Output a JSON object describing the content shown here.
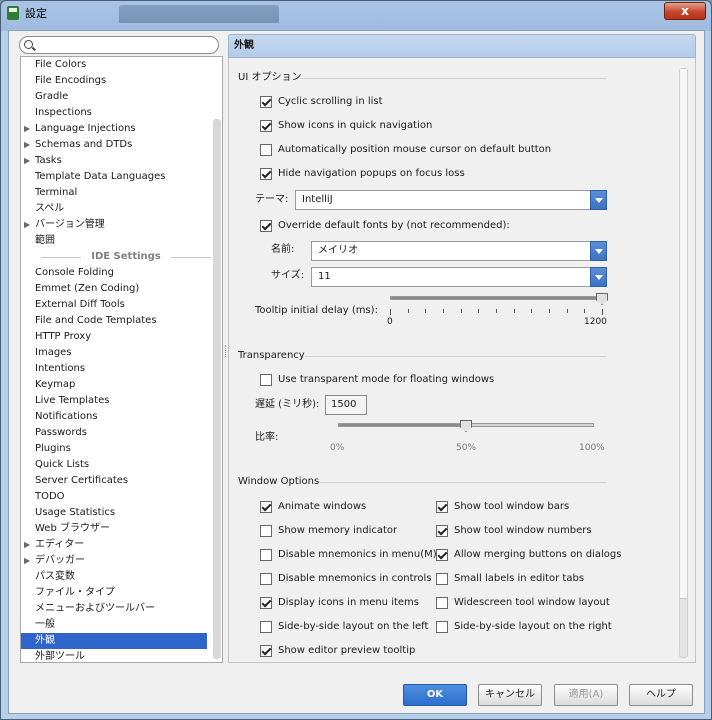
{
  "window": {
    "title": "設定",
    "close_label": "x"
  },
  "search": {
    "placeholder": ""
  },
  "tree": {
    "items_top": [
      {
        "label": "File Colors",
        "arrow": false
      },
      {
        "label": "File Encodings",
        "arrow": false
      },
      {
        "label": "Gradle",
        "arrow": false
      },
      {
        "label": "Inspections",
        "arrow": false
      },
      {
        "label": "Language Injections",
        "arrow": true
      },
      {
        "label": "Schemas and DTDs",
        "arrow": true
      },
      {
        "label": "Tasks",
        "arrow": true
      },
      {
        "label": "Template Data Languages",
        "arrow": false
      },
      {
        "label": "Terminal",
        "arrow": false
      },
      {
        "label": "スペル",
        "arrow": false
      },
      {
        "label": "バージョン管理",
        "arrow": true
      },
      {
        "label": "範囲",
        "arrow": false
      }
    ],
    "separator": "IDE Settings",
    "items_bottom": [
      {
        "label": "Console Folding",
        "arrow": false
      },
      {
        "label": "Emmet (Zen Coding)",
        "arrow": false
      },
      {
        "label": "External Diff Tools",
        "arrow": false
      },
      {
        "label": "File and Code Templates",
        "arrow": false
      },
      {
        "label": "HTTP Proxy",
        "arrow": false
      },
      {
        "label": "Images",
        "arrow": false
      },
      {
        "label": "Intentions",
        "arrow": false
      },
      {
        "label": "Keymap",
        "arrow": false
      },
      {
        "label": "Live Templates",
        "arrow": false
      },
      {
        "label": "Notifications",
        "arrow": false
      },
      {
        "label": "Passwords",
        "arrow": false
      },
      {
        "label": "Plugins",
        "arrow": false
      },
      {
        "label": "Quick Lists",
        "arrow": false
      },
      {
        "label": "Server Certificates",
        "arrow": false
      },
      {
        "label": "TODO",
        "arrow": false
      },
      {
        "label": "Usage Statistics",
        "arrow": false
      },
      {
        "label": "Web ブラウザー",
        "arrow": false
      },
      {
        "label": "エディター",
        "arrow": true
      },
      {
        "label": "デバッガー",
        "arrow": true
      },
      {
        "label": "パス変数",
        "arrow": false
      },
      {
        "label": "ファイル・タイプ",
        "arrow": false
      },
      {
        "label": "メニューおよびツールバー",
        "arrow": false
      },
      {
        "label": "一般",
        "arrow": false
      },
      {
        "label": "外観",
        "arrow": false,
        "selected": true
      },
      {
        "label": "外部ツール",
        "arrow": false
      }
    ]
  },
  "panel": {
    "title": "外観",
    "ui_options": {
      "heading": "UI オプション",
      "cyclic_scrolling": {
        "label": "Cyclic scrolling in list",
        "checked": true
      },
      "show_icons_quick_nav": {
        "label": "Show icons in quick navigation",
        "checked": true
      },
      "auto_position_mouse": {
        "label": "Automatically position mouse cursor on default button",
        "checked": false
      },
      "hide_nav_popups": {
        "label": "Hide navigation popups on focus loss",
        "checked": true
      },
      "theme_label": "テーマ:",
      "theme_value": "IntelliJ",
      "override_fonts": {
        "label": "Override default fonts by (not recommended):",
        "checked": true
      },
      "font_name_label": "名前:",
      "font_name_value": "メイリオ",
      "font_size_label": "サイズ:",
      "font_size_value": "11",
      "tooltip_label": "Tooltip initial delay (ms):",
      "tooltip_min": "0",
      "tooltip_max": "1200",
      "tooltip_value": 1200
    },
    "transparency": {
      "heading": "Transparency",
      "use_transparent": {
        "label": "Use transparent mode for floating windows",
        "checked": false
      },
      "delay_label": "遅延 (ミリ秒):",
      "delay_value": "1500",
      "ratio_label": "比率:",
      "ratio_ticks": [
        "0%",
        "50%",
        "100%"
      ],
      "ratio_value_percent": 50
    },
    "window_options": {
      "heading": "Window Options",
      "left": [
        {
          "label": "Animate windows",
          "checked": true
        },
        {
          "label": "Show memory indicator",
          "checked": false
        },
        {
          "label": "Disable mnemonics in menu(M)",
          "checked": false
        },
        {
          "label": "Disable mnemonics in controls",
          "checked": false
        },
        {
          "label": "Display icons in menu items",
          "checked": true
        },
        {
          "label": "Side-by-side layout on the left",
          "checked": false
        },
        {
          "label": "Show editor preview tooltip",
          "checked": true
        }
      ],
      "right": [
        {
          "label": "Show tool window bars",
          "checked": true
        },
        {
          "label": "Show tool window numbers",
          "checked": true
        },
        {
          "label": "Allow merging buttons on dialogs",
          "checked": true
        },
        {
          "label": "Small labels in editor tabs",
          "checked": false
        },
        {
          "label": "Widescreen tool window layout",
          "checked": false
        },
        {
          "label": "Side-by-side layout on the right",
          "checked": false
        }
      ]
    }
  },
  "buttons": {
    "ok": "OK",
    "cancel": "キャンセル",
    "apply": "適用(A)",
    "help": "ヘルプ"
  }
}
